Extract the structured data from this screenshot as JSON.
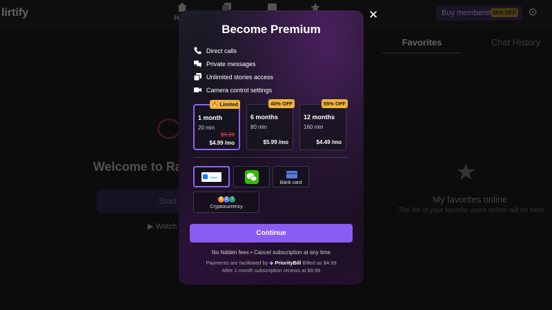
{
  "app": {
    "logo": "lirtify",
    "nav": {
      "home_label": "H"
    },
    "buy_membership": {
      "label": "Buy membership",
      "badge": "36% OFF"
    }
  },
  "background": {
    "welcome": "Welcome to Rand",
    "start_button": "Start c",
    "watch_button": "Watch",
    "tabs": [
      "Favorites",
      "Chat History"
    ],
    "favorites_empty": {
      "title": "My favorites online",
      "subtitle": "The list of your favorite users online will be here"
    }
  },
  "modal": {
    "title": "Become Premium",
    "features": [
      {
        "icon": "phone-icon",
        "label": "Direct calls"
      },
      {
        "icon": "chat-icon",
        "label": "Private messages"
      },
      {
        "icon": "stories-icon",
        "label": "Unlimited stories access"
      },
      {
        "icon": "camera-icon",
        "label": "Camera control settings"
      }
    ],
    "plans": [
      {
        "name": "1 month",
        "duration": "20 min",
        "old_price": "$9.99",
        "price": "$4.99 /mo",
        "badge": "Limited",
        "selected": true
      },
      {
        "name": "6 months",
        "duration": "80 min",
        "old_price": "",
        "price": "$5.99 /mo",
        "badge": "40% OFF",
        "selected": false
      },
      {
        "name": "12 months",
        "duration": "160 min",
        "old_price": "",
        "price": "$4.49 /mo",
        "badge": "55% OFF",
        "selected": false
      }
    ],
    "payment_methods": [
      {
        "name": "Alipay",
        "label": "",
        "selected": true
      },
      {
        "name": "WeChat Pay",
        "label": "",
        "selected": false
      },
      {
        "name": "Bank card",
        "label": "Bank card",
        "selected": false
      },
      {
        "name": "Cryptocurrency",
        "label": "Cryptocurrency",
        "selected": false
      }
    ],
    "alipay_text": "Alipay",
    "crypto_coin_letters": [
      "B",
      "E",
      "T"
    ],
    "continue_label": "Continue",
    "notes": {
      "line1": "No hidden fees • Cancel subscription at any time",
      "line2_prefix": "Payments are facilitated by",
      "line2_brand": "PriorityBill",
      "line2_suffix": "Billed as $4.99",
      "line3": "After 1 month subscription renews at $9.99"
    },
    "colors": {
      "accent": "#8a5cf2",
      "badge": "#f0b33a",
      "old_price": "#e0433f"
    }
  }
}
